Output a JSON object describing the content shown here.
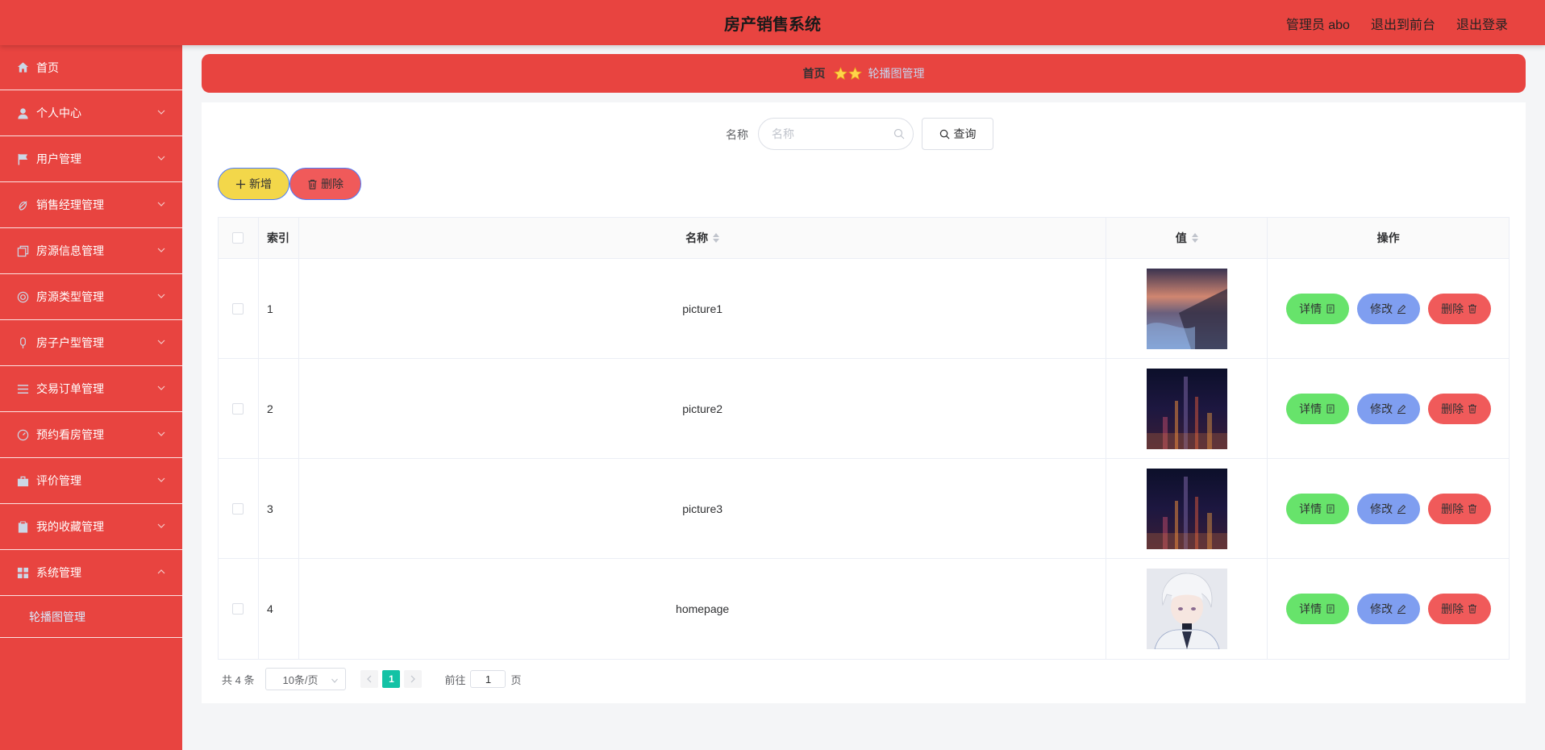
{
  "header": {
    "title": "房产销售系统",
    "admin": "管理员 abo",
    "to_frontend": "退出到前台",
    "logout": "退出登录"
  },
  "sidebar": {
    "items": [
      {
        "label": "首页",
        "icon": "home-icon"
      },
      {
        "label": "个人中心",
        "icon": "user-icon"
      },
      {
        "label": "用户管理",
        "icon": "flag-icon"
      },
      {
        "label": "销售经理管理",
        "icon": "bell-icon"
      },
      {
        "label": "房源信息管理",
        "icon": "copy-icon"
      },
      {
        "label": "房源类型管理",
        "icon": "globe-icon"
      },
      {
        "label": "房子户型管理",
        "icon": "microphone-icon"
      },
      {
        "label": "交易订单管理",
        "icon": "list-icon"
      },
      {
        "label": "预约看房管理",
        "icon": "gauge-icon"
      },
      {
        "label": "评价管理",
        "icon": "briefcase-icon"
      },
      {
        "label": "我的收藏管理",
        "icon": "clipboard-icon"
      },
      {
        "label": "系统管理",
        "icon": "grid-icon"
      }
    ],
    "sub_item": "轮播图管理"
  },
  "breadcrumb": {
    "home": "首页",
    "current": "轮播图管理"
  },
  "search": {
    "label": "名称",
    "placeholder": "名称",
    "button": "查询"
  },
  "actions": {
    "add": "新增",
    "delete": "删除"
  },
  "table": {
    "headers": {
      "index": "索引",
      "name": "名称",
      "value": "值",
      "operation": "操作"
    },
    "rows": [
      {
        "index": "1",
        "name": "picture1",
        "image": "landscape-sunset"
      },
      {
        "index": "2",
        "name": "picture2",
        "image": "city-night"
      },
      {
        "index": "3",
        "name": "picture3",
        "image": "city-night"
      },
      {
        "index": "4",
        "name": "homepage",
        "image": "anime-portrait"
      }
    ],
    "ops": {
      "detail": "详情",
      "edit": "修改",
      "remove": "删除"
    }
  },
  "pagination": {
    "total": "共 4 条",
    "page_size": "10条/页",
    "current_page": "1",
    "goto_prefix": "前往",
    "goto_value": "1",
    "goto_suffix": "页"
  },
  "colors": {
    "primary": "#e84440",
    "detail": "#67e36b",
    "edit": "#7f9ef0",
    "remove": "#f05a5a",
    "add": "#f3d74a",
    "page_active": "#13c2a5"
  }
}
